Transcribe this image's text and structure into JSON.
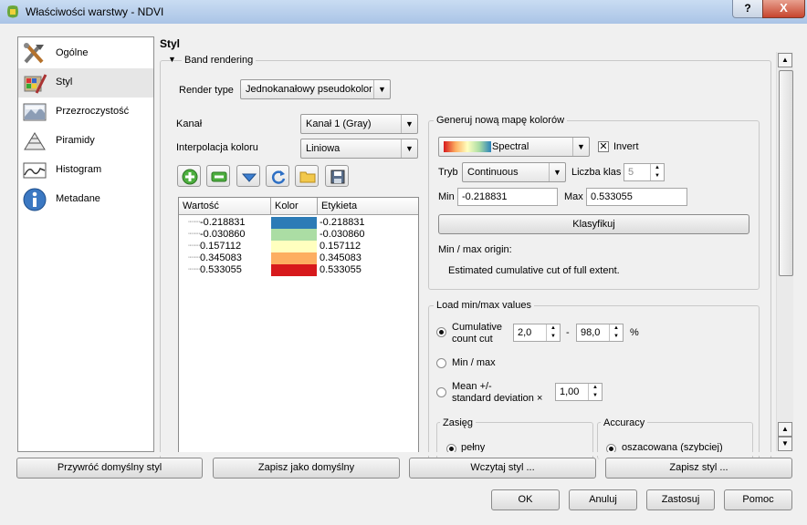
{
  "window": {
    "title": "Właściwości warstwy - NDVI",
    "help_glyph": "?",
    "close_glyph": "X"
  },
  "sidebar": {
    "items": [
      {
        "label": "Ogólne",
        "icon": "tools-icon"
      },
      {
        "label": "Styl",
        "icon": "paint-brush-icon"
      },
      {
        "label": "Przezroczystość",
        "icon": "transparency-icon"
      },
      {
        "label": "Piramidy",
        "icon": "pyramid-icon"
      },
      {
        "label": "Histogram",
        "icon": "histogram-icon"
      },
      {
        "label": "Metadane",
        "icon": "info-icon"
      }
    ]
  },
  "section_title": "Styl",
  "band_rendering": {
    "title": "Band rendering",
    "render_type_label": "Render type",
    "render_type_value": "Jednokanałowy pseudokolor",
    "band_label": "Kanał",
    "band_value": "Kanał 1 (Gray)",
    "interp_label": "Interpolacja koloru",
    "interp_value": "Liniowa"
  },
  "toolbar_icons": [
    "add-class-icon",
    "remove-class-icon",
    "sort-icon",
    "load-from-band-icon",
    "open-file-icon",
    "save-file-icon"
  ],
  "color_table": {
    "headers": [
      "Wartość",
      "Kolor",
      "Etykieta"
    ],
    "rows": [
      {
        "value": "-0.218831",
        "color": "#2c7bb6",
        "label": "-0.218831"
      },
      {
        "value": "-0.030860",
        "color": "#abdda4",
        "label": "-0.030860"
      },
      {
        "value": "0.157112",
        "color": "#ffffbf",
        "label": "0.157112"
      },
      {
        "value": "0.345083",
        "color": "#fdae61",
        "label": "0.345083"
      },
      {
        "value": "0.533055",
        "color": "#d7191c",
        "label": "0.533055"
      }
    ]
  },
  "generate": {
    "title": "Generuj nową mapę kolorów",
    "ramp_value": "Spectral",
    "invert_label": "Invert",
    "invert_checked": true,
    "mode_label": "Tryb",
    "mode_value": "Continuous",
    "classes_label": "Liczba klas",
    "classes_value": "5",
    "min_label": "Min",
    "min_value": "-0.218831",
    "max_label": "Max",
    "max_value": "0.533055",
    "classify_label": "Klasyfikuj",
    "origin_label": "Min / max origin:",
    "origin_text": "Estimated cumulative cut  of  full extent."
  },
  "load_minmax": {
    "title": "Load min/max values",
    "cumulative_label_1": "Cumulative",
    "cumulative_label_2": "count cut",
    "cut_low": "2,0",
    "dash": "-",
    "cut_high": "98,0",
    "percent": "%",
    "minmax_label": "Min / max",
    "mean_label_1": "Mean +/-",
    "mean_label_2": "standard deviation ×",
    "stddev_value": "1,00",
    "extent_title": "Zasięg",
    "extent_option": "pełny",
    "accuracy_title": "Accuracy",
    "accuracy_option": "oszacowana (szybciej)"
  },
  "style_buttons": [
    "Przywróć domyślny styl",
    "Zapisz jako domyślny",
    "Wczytaj styl ...",
    "Zapisz styl ..."
  ],
  "dialog_buttons": [
    "OK",
    "Anuluj",
    "Zastosuj",
    "Pomoc"
  ]
}
